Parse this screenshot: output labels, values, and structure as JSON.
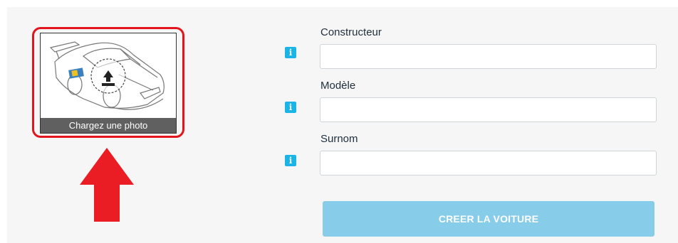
{
  "photo": {
    "caption": "Chargez une photo",
    "icon": "upload-icon"
  },
  "fields": [
    {
      "label": "Constructeur",
      "value": "",
      "placeholder": ""
    },
    {
      "label": "Modèle",
      "value": "",
      "placeholder": ""
    },
    {
      "label": "Surnom",
      "value": "",
      "placeholder": ""
    }
  ],
  "info_icon": "i",
  "submit_label": "CREER LA VOITURE",
  "colors": {
    "highlight": "#e3141b",
    "info": "#1ab4e6",
    "button": "#87cdea"
  }
}
